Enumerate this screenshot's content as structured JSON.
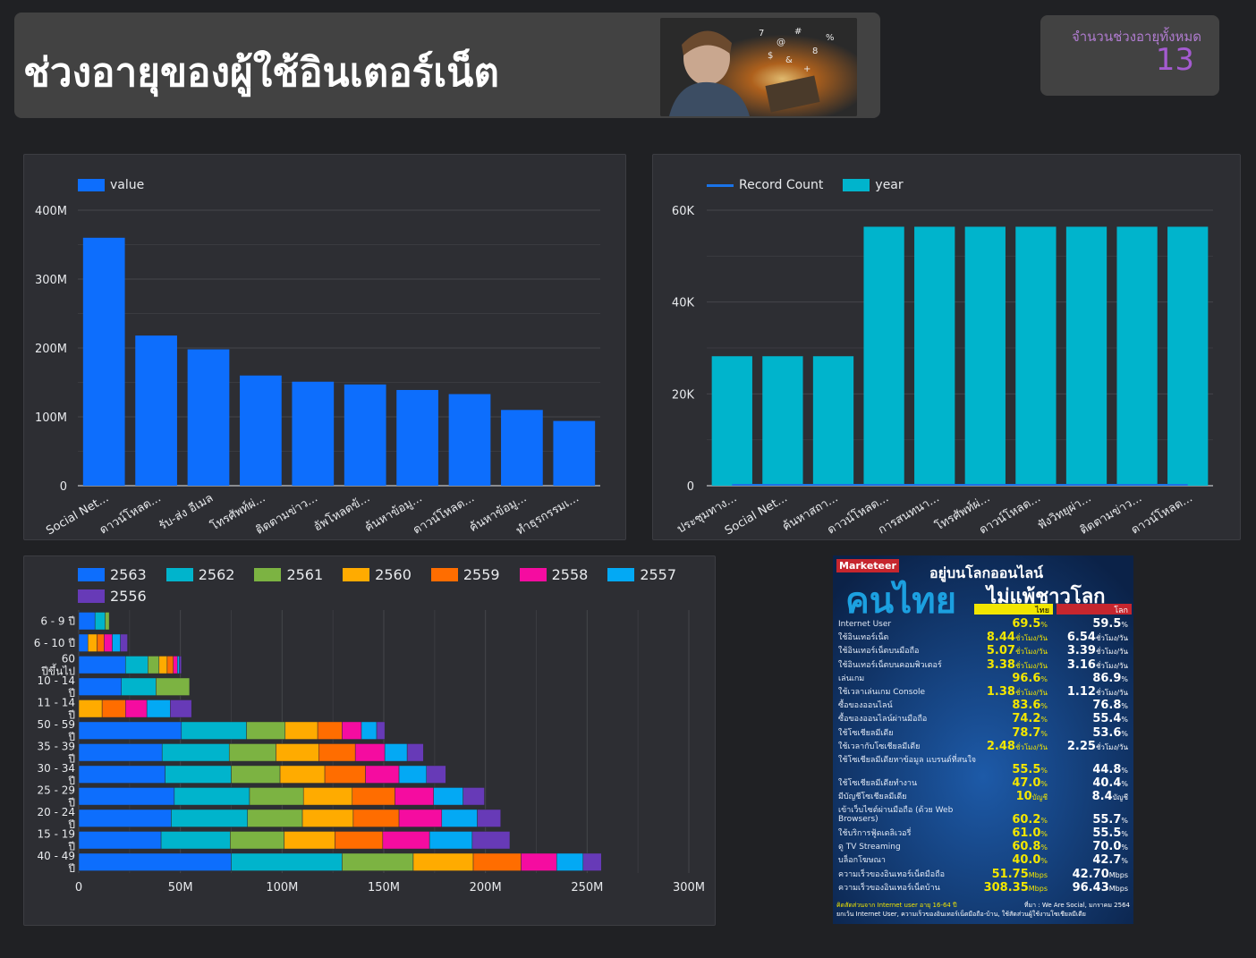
{
  "header": {
    "title": "ช่วงอายุของผู้ใช้อินเตอร์เน็ต"
  },
  "kpi": {
    "label": "จำนวนช่วงอายุทั้งหมด",
    "value": "13",
    "color": "#a45bd0"
  },
  "chart_data": [
    {
      "type": "bar",
      "series": [
        {
          "name": "value",
          "color": "#0d6efd"
        }
      ],
      "categories": [
        "Social Net...",
        "ดาวน์โหลด...",
        "รับ-ส่ง อีเมล",
        "โทรศัพท์ผ่...",
        "ติดตามข่าว...",
        "อัพโหลดข้...",
        "ค้นหาข้อมู...",
        "ดาวน์โหลด...",
        "ค้นหาข้อมู...",
        "ทำธุรกรรมเ..."
      ],
      "values": [
        360000000,
        218000000,
        198000000,
        160000000,
        151000000,
        147000000,
        139000000,
        133000000,
        110000000,
        94000000
      ],
      "yticks": [
        "0",
        "100M",
        "200M",
        "300M",
        "400M"
      ],
      "ylim": [
        0,
        400000000
      ],
      "grid": true,
      "legend": "top-left"
    },
    {
      "type": "bar",
      "series": [
        {
          "name": "Record Count",
          "kind": "line",
          "color": "#1a73e8",
          "values": [
            0,
            0,
            0,
            0,
            0,
            0,
            0,
            0,
            0,
            0
          ]
        },
        {
          "name": "year",
          "kind": "bar",
          "color": "#00b4cc",
          "values": [
            28200,
            28200,
            28200,
            56400,
            56400,
            56400,
            56400,
            56400,
            56400,
            56400
          ]
        }
      ],
      "categories": [
        "ประชุมทาง...",
        "Social Net...",
        "ค้นหาสถา...",
        "ดาวน์โหลด...",
        "การสนทนา...",
        "โทรศัพท์ผ่...",
        "ดาวน์โหลด...",
        "ฟังวิทยุผ่า...",
        "ติดตามข่าว...",
        "ดาวน์โหลด..."
      ],
      "yticks": [
        "0",
        "20K",
        "40K",
        "60K"
      ],
      "ylim": [
        0,
        60000
      ],
      "grid": true,
      "legend": "top-left"
    },
    {
      "type": "bar",
      "orientation": "horizontal",
      "stacked": true,
      "legend": "top-left",
      "categories": [
        "6 - 9 ปี",
        "6 - 10 ปี",
        "60 ปีขึ้นไป",
        "10 - 14 ปี",
        "11 - 14 ปี",
        "50 - 59 ปี",
        "35 - 39 ปี",
        "30 - 34 ปี",
        "25 - 29 ปี",
        "20 - 24 ปี",
        "15 - 19 ปี",
        "40 - 49 ปี"
      ],
      "xticks": [
        "0",
        "50M",
        "100M",
        "150M",
        "200M",
        "250M",
        "300M"
      ],
      "xlim": [
        0,
        300000000
      ],
      "series": [
        {
          "name": "2563",
          "color": "#0d6efd",
          "values": [
            8000000,
            4500000,
            23000000,
            21000000,
            0,
            50500000,
            41000000,
            42500000,
            47000000,
            45500000,
            40500000,
            75000000
          ]
        },
        {
          "name": "2562",
          "color": "#00b4cc",
          "values": [
            5000000,
            0,
            11000000,
            17000000,
            0,
            32000000,
            33000000,
            32500000,
            37000000,
            37500000,
            34000000,
            54500000
          ]
        },
        {
          "name": "2561",
          "color": "#7cb342",
          "values": [
            2000000,
            0,
            5500000,
            16500000,
            0,
            19000000,
            23000000,
            24000000,
            26500000,
            27000000,
            26500000,
            35000000
          ]
        },
        {
          "name": "2560",
          "color": "#ffab00",
          "values": [
            0,
            4500000,
            4000000,
            0,
            11500000,
            16000000,
            21000000,
            22000000,
            24000000,
            25000000,
            25000000,
            29500000
          ]
        },
        {
          "name": "2559",
          "color": "#ff6d00",
          "values": [
            0,
            3500000,
            3000000,
            0,
            11500000,
            12000000,
            18000000,
            20000000,
            21000000,
            22500000,
            23500000,
            23500000
          ]
        },
        {
          "name": "2558",
          "color": "#f50ca0",
          "values": [
            0,
            4000000,
            2000000,
            0,
            10500000,
            9500000,
            14500000,
            16500000,
            19000000,
            21000000,
            23000000,
            17500000
          ]
        },
        {
          "name": "2557",
          "color": "#03a9f4",
          "values": [
            0,
            4000000,
            1000000,
            0,
            11500000,
            7500000,
            11000000,
            13500000,
            14500000,
            17500000,
            21000000,
            13000000
          ]
        },
        {
          "name": "2556",
          "color": "#673ab7",
          "values": [
            0,
            3500000,
            1000000,
            0,
            10500000,
            4000000,
            8000000,
            9500000,
            10500000,
            11500000,
            18500000,
            9000000
          ]
        }
      ]
    }
  ],
  "infographic": {
    "brand": "Marketeer",
    "headline_big": "คนไทย",
    "headline_top": "อยู่บนโลกออนไลน์",
    "headline_sub": "ไม่แพ้ชาวโลก",
    "col_thai": "ไทย",
    "col_world": "โลก",
    "rows": [
      {
        "label": "Internet User",
        "thai": "69.5",
        "thai_unit": "%",
        "world": "59.5",
        "world_unit": "%"
      },
      {
        "label": "ใช้อินเทอร์เน็ต",
        "thai": "8.44",
        "thai_unit": "ชั่วโมง/วัน",
        "world": "6.54",
        "world_unit": "ชั่วโมง/วัน"
      },
      {
        "label": "ใช้อินเทอร์เน็ตบนมือถือ",
        "thai": "5.07",
        "thai_unit": "ชั่วโมง/วัน",
        "world": "3.39",
        "world_unit": "ชั่วโมง/วัน"
      },
      {
        "label": "ใช้อินเทอร์เน็ตบนคอมพิวเตอร์",
        "thai": "3.38",
        "thai_unit": "ชั่วโมง/วัน",
        "world": "3.16",
        "world_unit": "ชั่วโมง/วัน"
      },
      {
        "label": "เล่นเกม",
        "thai": "96.6",
        "thai_unit": "%",
        "world": "86.9",
        "world_unit": "%"
      },
      {
        "label": "ใช้เวลาเล่นเกม Console",
        "thai": "1.38",
        "thai_unit": "ชั่วโมง/วัน",
        "world": "1.12",
        "world_unit": "ชั่วโมง/วัน"
      },
      {
        "label": "ซื้อของออนไลน์",
        "thai": "83.6",
        "thai_unit": "%",
        "world": "76.8",
        "world_unit": "%"
      },
      {
        "label": "ซื้อของออนไลน์ผ่านมือถือ",
        "thai": "74.2",
        "thai_unit": "%",
        "world": "55.4",
        "world_unit": "%"
      },
      {
        "label": "ใช้โซเชียลมีเดีย",
        "thai": "78.7",
        "thai_unit": "%",
        "world": "53.6",
        "world_unit": "%"
      },
      {
        "label": "ใช้เวลากับโซเชียลมีเดีย",
        "thai": "2.48",
        "thai_unit": "ชั่วโมง/วัน",
        "world": "2.25",
        "world_unit": "ชั่วโมง/วัน"
      },
      {
        "label": "ใช้โซเชียลมีเดียหาข้อมูล แบรนด์ที่สนใจ",
        "thai": "55.5",
        "thai_unit": "%",
        "world": "44.8",
        "world_unit": "%"
      },
      {
        "label": "ใช้โซเชียลมีเดียทำงาน",
        "thai": "47.0",
        "thai_unit": "%",
        "world": "40.4",
        "world_unit": "%"
      },
      {
        "label": "มีบัญชีโซเชียลมีเดีย",
        "thai": "10",
        "thai_unit": "บัญชี",
        "world": "8.4",
        "world_unit": "บัญชี"
      },
      {
        "label": "เข้าเว็บไซต์ผ่านมือถือ (ด้วย Web Browsers)",
        "thai": "60.2",
        "thai_unit": "%",
        "world": "55.7",
        "world_unit": "%"
      },
      {
        "label": "ใช้บริการฟู้ดเดลิเวอรี่",
        "thai": "61.0",
        "thai_unit": "%",
        "world": "55.5",
        "world_unit": "%"
      },
      {
        "label": "ดู TV Streaming",
        "thai": "60.8",
        "thai_unit": "%",
        "world": "70.0",
        "world_unit": "%"
      },
      {
        "label": "บล็อกโฆษณา",
        "thai": "40.0",
        "thai_unit": "%",
        "world": "42.7",
        "world_unit": "%"
      },
      {
        "label": "ความเร็วของอินเทอร์เน็ตมือถือ",
        "thai": "51.75",
        "thai_unit": "Mbps",
        "world": "42.70",
        "world_unit": "Mbps"
      },
      {
        "label": "ความเร็วของอินเทอร์เน็ตบ้าน",
        "thai": "308.35",
        "thai_unit": "Mbps",
        "world": "96.43",
        "world_unit": "Mbps"
      }
    ],
    "footnote": "คิดสัดส่วนจาก Internet user อายุ 16-64 ปี",
    "footnote2": "ยกเว้น Internet User, ความเร็วของอินเทอร์เน็ตมือถือ-บ้าน, ใช้สัดส่วนผู้ใช้งานโซเชียลมีเดีย",
    "source": "ที่มา : We Are Social, มกราคม 2564"
  }
}
